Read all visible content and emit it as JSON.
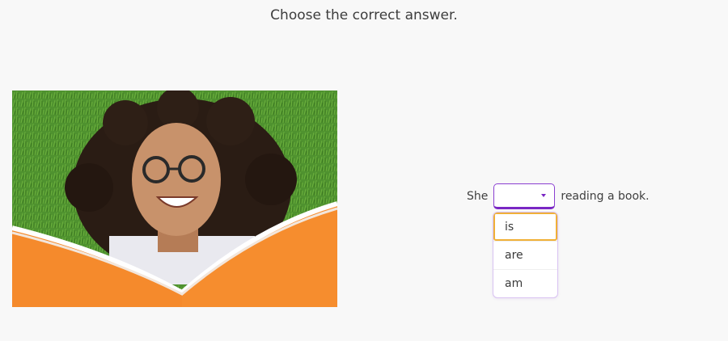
{
  "instruction": "Choose the correct answer.",
  "image": {
    "description_icon": "photo-girl-reading-book"
  },
  "sentence": {
    "before": "She",
    "after": "reading a book.",
    "selected_value": ""
  },
  "dropdown": {
    "options": [
      {
        "label": "is"
      },
      {
        "label": "are"
      },
      {
        "label": "am"
      }
    ],
    "highlighted_index": 0
  },
  "colors": {
    "accent": "#7a27c4",
    "highlight_border": "#f0b037",
    "book_orange": "#f58a2c",
    "grass": "#4d8f2e"
  }
}
